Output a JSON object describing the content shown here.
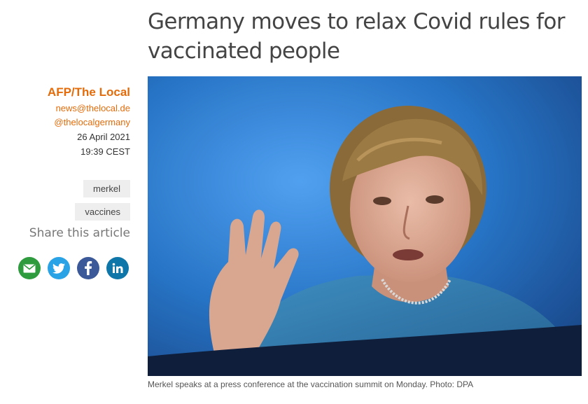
{
  "article": {
    "headline": "Germany moves to relax Covid rules for vaccinated people",
    "caption": "Merkel speaks at a press conference at the vaccination summit on Monday. Photo: DPA"
  },
  "byline": {
    "author": "AFP/The Local",
    "email": "news@thelocal.de",
    "twitter": "@thelocalgermany",
    "date": "26 April 2021",
    "time": "19:39 CEST"
  },
  "tags": [
    "merkel",
    "vaccines"
  ],
  "share": {
    "title": "Share this article",
    "buttons": [
      {
        "name": "email",
        "icon": "envelope-icon",
        "color": "#2e9b3f"
      },
      {
        "name": "twitter",
        "icon": "twitter-bird-icon",
        "color": "#2aa3e6"
      },
      {
        "name": "facebook",
        "icon": "facebook-f-icon",
        "color": "#3b5998"
      },
      {
        "name": "linkedin",
        "icon": "linkedin-in-icon",
        "color": "#0e76a8"
      }
    ]
  },
  "colors": {
    "accent": "#e36b0a",
    "photo_background": "#1f6fc4"
  }
}
